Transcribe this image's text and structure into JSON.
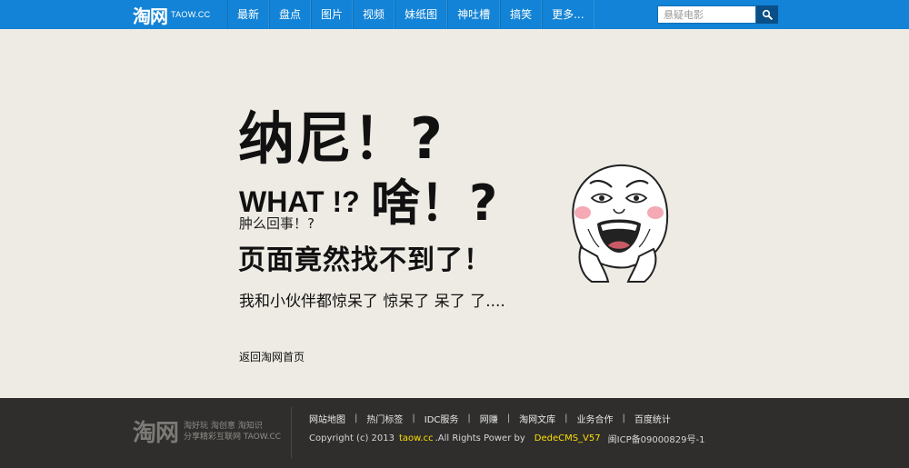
{
  "header": {
    "logo_text": "淘网",
    "logo_domain": "TAOW.CC",
    "nav": [
      "最新",
      "盘点",
      "图片",
      "视频",
      "妹纸图",
      "神吐槽",
      "搞笑",
      "更多..."
    ],
    "search_placeholder": "悬疑电影",
    "accent_color": "#1283d6"
  },
  "main": {
    "line1": "纳尼！?",
    "line2": "WHAT !?",
    "line3": "啥！?",
    "line4": "肿么回事！?",
    "line5": "页面竟然找不到了！",
    "line6": "我和小伙伴都惊呆了 惊呆了 呆了 了....",
    "back_link": "返回淘网首页",
    "meme_icon": "rage-face-icon"
  },
  "footer": {
    "logo_text": "淘网",
    "slogan_line1": "淘好玩 淘创意 淘知识",
    "slogan_line2": "分享精彩互联网 TAOW.CC",
    "links": [
      "网站地图",
      "热门标签",
      "IDC服务",
      "网赚",
      "淘网文库",
      "业务合作",
      "百度统计"
    ],
    "separator": "|",
    "copyright_prefix": "Copyright (c) 2013",
    "copyright_site": "taow.cc",
    "copyright_suffix": ".All Rights Power by",
    "cms": "DedeCMS_V57",
    "icp": "闽ICP备09000829号-1"
  }
}
